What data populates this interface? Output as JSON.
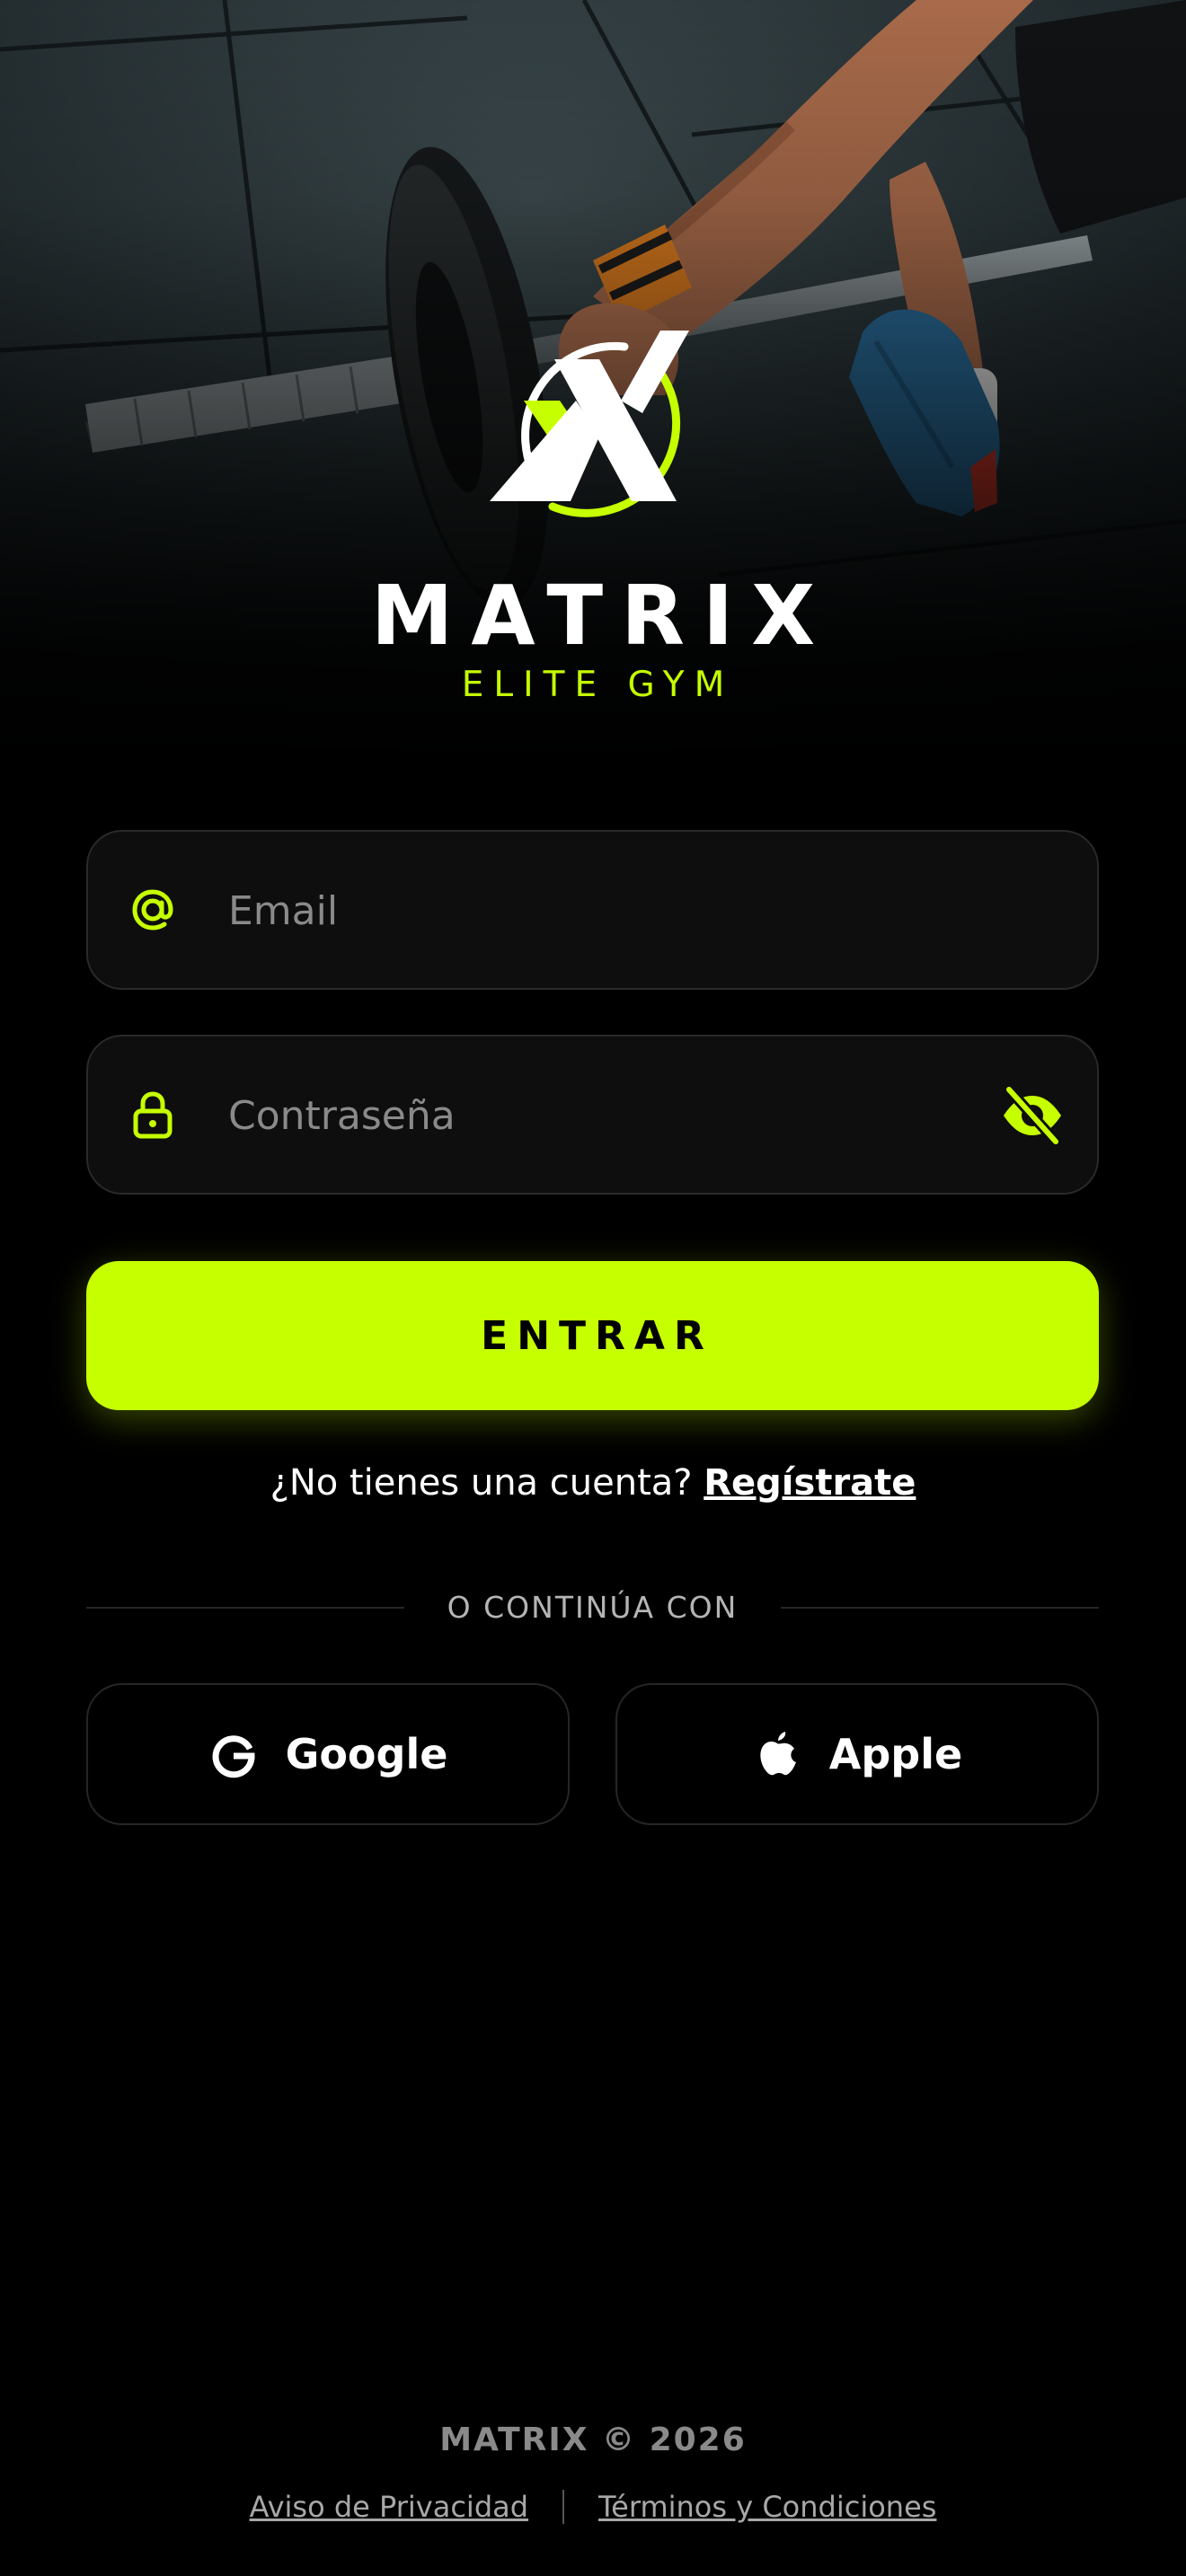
{
  "brand": {
    "name": "MATRIX",
    "tagline": "ELITE GYM",
    "accent_color": "#c6ff00"
  },
  "login_form": {
    "email_placeholder": "Email",
    "email_icon": "at-icon",
    "password_placeholder": "Contraseña",
    "password_icon": "lock-icon",
    "password_toggle_icon": "eye-slash-icon",
    "submit_label": "ENTRAR"
  },
  "signup": {
    "prompt": "¿No tienes una cuenta?",
    "link_label": "Regístrate"
  },
  "social_login": {
    "divider_label": "O CONTINÚA CON",
    "google_label": "Google",
    "apple_label": "Apple"
  },
  "footer": {
    "copyright": "MATRIX © 2026",
    "privacy_label": "Aviso de Privacidad",
    "terms_label": "Términos y Condiciones"
  }
}
